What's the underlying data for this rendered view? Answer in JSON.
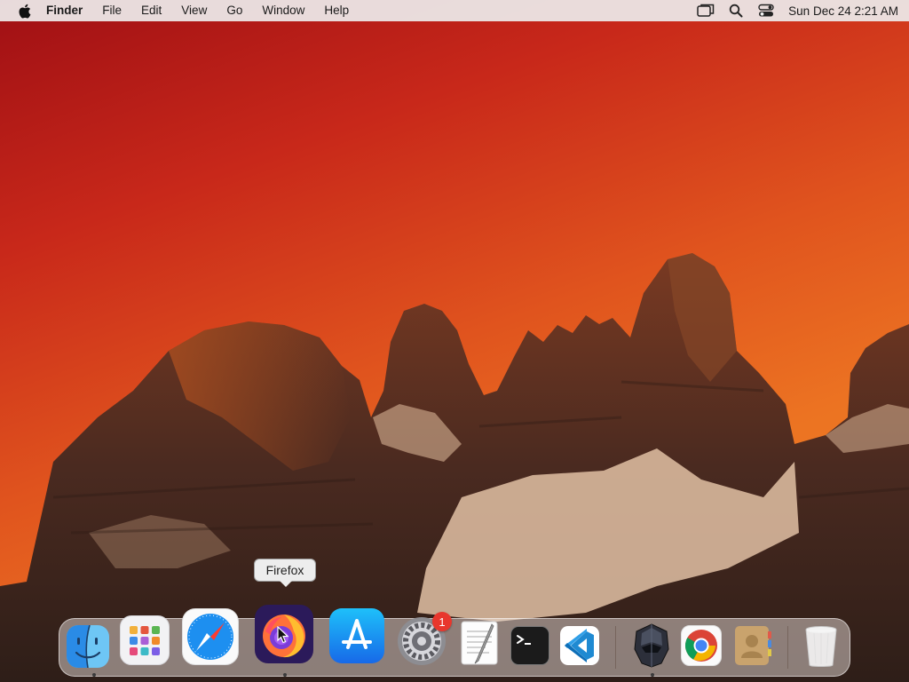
{
  "menubar": {
    "app_name": "Finder",
    "menus": [
      "File",
      "Edit",
      "View",
      "Go",
      "Window",
      "Help"
    ],
    "status_icons": [
      "screen-mirroring-icon",
      "spotlight-search-icon",
      "control-center-icon"
    ],
    "clock": "Sun Dec 24  2:21 AM"
  },
  "tooltip": {
    "text": "Firefox"
  },
  "dock": {
    "items": [
      {
        "name": "Finder",
        "icon": "finder-icon",
        "running": true
      },
      {
        "name": "Launchpad",
        "icon": "launchpad-icon",
        "running": false
      },
      {
        "name": "Safari",
        "icon": "safari-icon",
        "running": false
      },
      {
        "name": "Firefox",
        "icon": "firefox-icon",
        "running": true,
        "hovered": true
      },
      {
        "name": "App Store",
        "icon": "app-store-icon",
        "running": false
      },
      {
        "name": "System Preferences",
        "icon": "settings-gear-icon",
        "running": false,
        "badge": "1"
      },
      {
        "name": "TextEdit",
        "icon": "textedit-icon",
        "running": false
      },
      {
        "name": "Terminal",
        "icon": "terminal-icon",
        "running": false
      },
      {
        "name": "Visual Studio Code",
        "icon": "vscode-icon",
        "running": false
      },
      {
        "name": "Helmet App",
        "icon": "helmet-icon",
        "running": true
      },
      {
        "name": "Google Chrome",
        "icon": "chrome-icon",
        "running": false
      },
      {
        "name": "Contacts",
        "icon": "contacts-icon",
        "running": false
      },
      {
        "name": "Trash",
        "icon": "trash-icon",
        "running": false
      }
    ]
  },
  "colors": {
    "sky_top": "#9f0f14",
    "sky_bottom": "#f0882a",
    "badge": "#e8372d"
  }
}
